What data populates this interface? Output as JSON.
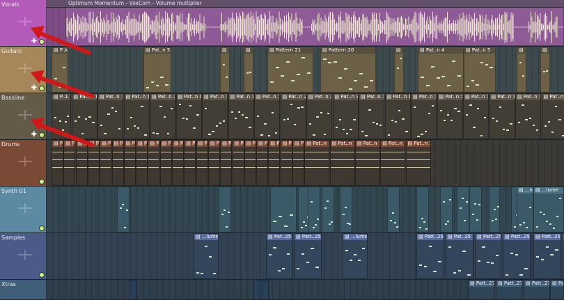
{
  "audio_clip_title": "Optimum Momentum - VoxCom - Volume multiplier",
  "tracks": [
    {
      "name": "Vocals",
      "color": "#b45ab8",
      "lane_color": "#7e4c84"
    },
    {
      "name": "Guitars",
      "color": "#a6875c",
      "lane_color": "#3c4a4e"
    },
    {
      "name": "Bassline",
      "color": "#645a48",
      "lane_color": "#3a4446"
    },
    {
      "name": "Drums",
      "color": "#7a4a36",
      "lane_color": "#3c3a36"
    },
    {
      "name": "Synth 01",
      "color": "#5c8aa2",
      "lane_color": "#33464f"
    },
    {
      "name": "Samples",
      "color": "#4c5a8a",
      "lane_color": "#334252"
    },
    {
      "name": "Xtras",
      "color": "#3e5e7a",
      "lane_color": "#2f3f4c"
    }
  ],
  "clip_labels": {
    "guitars": [
      "P..k",
      "Pat..n 5",
      "",
      "",
      "Pattern 21",
      "Pattern 20",
      "",
      "Pat..n 4",
      "Pat..n 5",
      "",
      ""
    ],
    "bassline": [
      "P..1",
      "Pat..n 1",
      "Pat..n 1",
      "Pat..n 1",
      "Pat..n 1",
      "Pat..n 1",
      "Pat..n 1",
      "Pat..n 1",
      "Pat..n 1",
      "Pat..n 2",
      "Pat..n 2",
      "Pat..n 3",
      "Pat..n 1",
      "Pat..n 1",
      "Pat..n 1",
      "Pat..n 1",
      "Pat..n 1",
      "Pat..n 1",
      "Pat..n 1",
      "Pat..n 1"
    ],
    "drums_short": "Pa",
    "drums_long": "Pat..n 1",
    "samples": [
      "...lume",
      "Pat..25",
      "Patt..25",
      "...lume",
      "Patt..25",
      "Pat..25",
      "Patt..25",
      "Patt..25",
      "Patt..25",
      "Patt..25"
    ],
    "synth_end": "...me",
    "synth_end2": "...lume",
    "xtras": [
      "Patt..27",
      "Patt..27",
      "Patt..27",
      "Patt..27"
    ]
  },
  "icons": {
    "clip_icon": "pattern-icon",
    "audio_icon": "waveform-icon",
    "add_icon": "plus-icon",
    "mute_icon": "led-icon"
  },
  "accent_colors": {
    "arrow": "#d01818",
    "note": "#cfe6c8",
    "led": "#c8f08a"
  }
}
